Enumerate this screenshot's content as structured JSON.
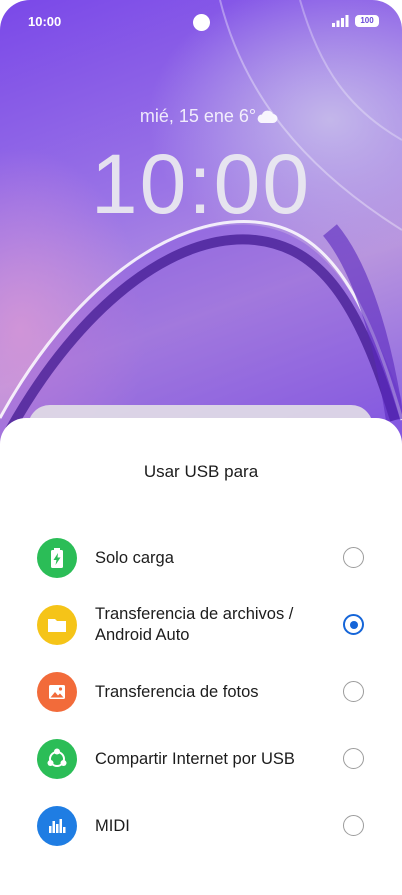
{
  "status_bar": {
    "time": "10:00",
    "battery": "100"
  },
  "lock_screen": {
    "date_weather": "mié, 15 ene  6°",
    "clock": "10:00"
  },
  "sheet": {
    "title": "Usar USB para",
    "selected_index": 1,
    "options": [
      {
        "label": "Solo carga",
        "icon": "battery-charging-icon",
        "color": "#2bbd57",
        "selected": false
      },
      {
        "label": "Transferencia de archivos / Android Auto",
        "icon": "folder-icon",
        "color": "#f5c418",
        "selected": true
      },
      {
        "label": "Transferencia de fotos",
        "icon": "image-icon",
        "color": "#f26b3a",
        "selected": false
      },
      {
        "label": "Compartir Internet por USB",
        "icon": "share-network-icon",
        "color": "#2bbd57",
        "selected": false
      },
      {
        "label": "MIDI",
        "icon": "equalizer-icon",
        "color": "#1f7de3",
        "selected": false
      }
    ]
  },
  "colors": {
    "accent": "#1565d8"
  }
}
